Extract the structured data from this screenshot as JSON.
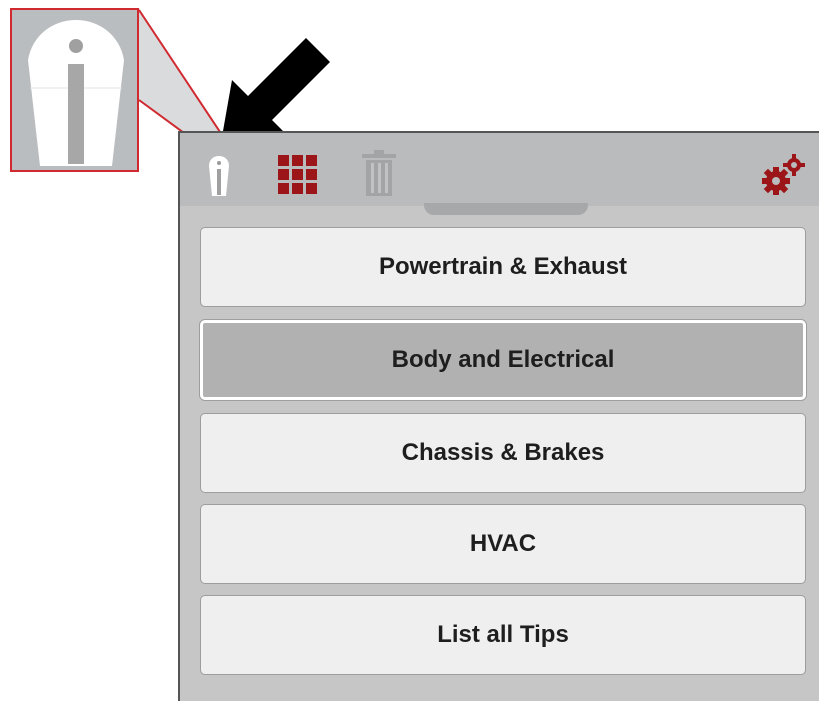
{
  "toolbar": {
    "icons": [
      "info-icon",
      "grid-icon",
      "trash-icon",
      "gears-icon"
    ]
  },
  "menu": {
    "items": [
      {
        "label": "Powertrain & Exhaust",
        "selected": false
      },
      {
        "label": "Body and Electrical",
        "selected": true
      },
      {
        "label": "Chassis & Brakes",
        "selected": false
      },
      {
        "label": "HVAC",
        "selected": false
      },
      {
        "label": "List all Tips",
        "selected": false
      }
    ]
  },
  "colors": {
    "accent": "#9b1519",
    "callout_border": "#d0292f",
    "toolbar_bg": "#b9bbbc",
    "button_bg": "#efefef",
    "selected_bg": "#b1b1b1"
  }
}
